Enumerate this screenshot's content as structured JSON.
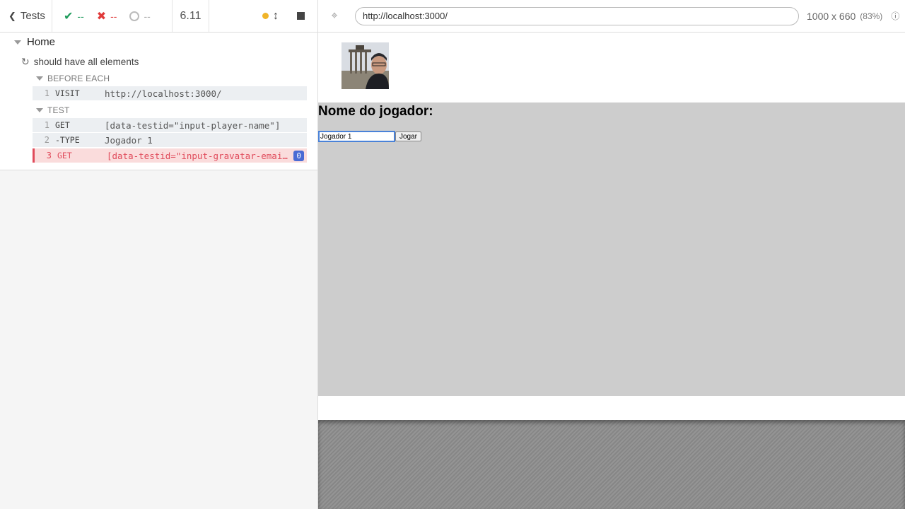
{
  "toolbar": {
    "tests_label": "Tests",
    "passed": "--",
    "failed": "--",
    "pending": "--",
    "duration": "6.11"
  },
  "runnable": {
    "suite": "Home",
    "test": "should have all elements",
    "before_each": {
      "label": "BEFORE EACH",
      "commands": [
        {
          "num": "1",
          "name": "VISIT",
          "message": "http://localhost:3000/"
        }
      ]
    },
    "test_block": {
      "label": "TEST",
      "commands": [
        {
          "num": "1",
          "name": "GET",
          "message": "[data-testid=\"input-player-name\"]"
        },
        {
          "num": "2",
          "name": "-TYPE",
          "message": "Jogador 1"
        },
        {
          "num": "3",
          "name": "GET",
          "message": "[data-testid=\"input-gravatar-email\"]",
          "badge": "0",
          "state": "failed"
        }
      ]
    }
  },
  "aut": {
    "url": "http://localhost:3000/",
    "viewport": "1000 x 660",
    "scale": "(83%)"
  },
  "app": {
    "heading": "Nome do jogador:",
    "input_value": "Jogador 1",
    "button_label": "Jogar"
  },
  "colors": {
    "pass": "#1e9b5b",
    "fail": "#e03b3b",
    "running": "#f0b429",
    "app_bg": "#cdcdcd"
  }
}
